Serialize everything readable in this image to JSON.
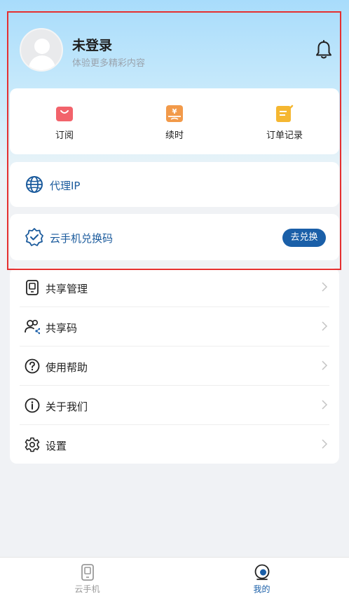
{
  "header": {
    "name": "未登录",
    "subtitle": "体验更多精彩内容"
  },
  "quick_actions": [
    {
      "label": "订阅",
      "icon": "shopping-bag-icon",
      "color": "#f2636b"
    },
    {
      "label": "续时",
      "icon": "renew-time-icon",
      "color": "#f29a4a"
    },
    {
      "label": "订单记录",
      "icon": "order-record-icon",
      "color": "#f5b731"
    }
  ],
  "proxy": {
    "label": "代理IP",
    "icon": "globe-icon"
  },
  "redeem": {
    "label": "云手机兑换码",
    "button": "去兑换",
    "icon": "verified-badge-icon"
  },
  "menu": [
    {
      "label": "共享管理",
      "icon": "share-manage-icon"
    },
    {
      "label": "共享码",
      "icon": "share-code-icon"
    },
    {
      "label": "使用帮助",
      "icon": "help-icon"
    },
    {
      "label": "关于我们",
      "icon": "info-icon"
    },
    {
      "label": "设置",
      "icon": "gear-icon"
    }
  ],
  "tabbar": [
    {
      "label": "云手机",
      "icon": "cloud-phone-icon",
      "active": false
    },
    {
      "label": "我的",
      "icon": "profile-icon",
      "active": true
    }
  ],
  "colors": {
    "accent": "#1a5fa8",
    "highlight_border": "#e53030"
  }
}
